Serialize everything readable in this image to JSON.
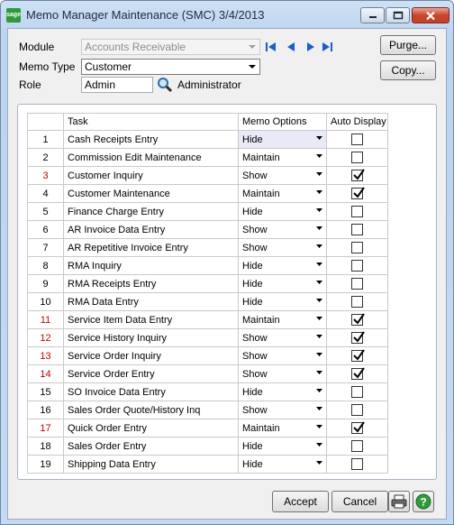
{
  "window": {
    "title": "Memo Manager Maintenance (SMC) 3/4/2013",
    "app_logo_text": "sage"
  },
  "form": {
    "module_label": "Module",
    "module_value": "Accounts Receivable",
    "memo_type_label": "Memo Type",
    "memo_type_value": "Customer",
    "role_label": "Role",
    "role_value": "Admin",
    "role_description": "Administrator"
  },
  "buttons": {
    "purge": "Purge...",
    "copy": "Copy...",
    "accept": "Accept",
    "cancel": "Cancel"
  },
  "grid": {
    "headers": [
      "",
      "Task",
      "Memo Options",
      "Auto Display"
    ],
    "rows": [
      {
        "num": "1",
        "task": "Cash Receipts Entry",
        "option": "Hide",
        "auto": false,
        "red": false
      },
      {
        "num": "2",
        "task": "Commission Edit Maintenance",
        "option": "Maintain",
        "auto": false,
        "red": false
      },
      {
        "num": "3",
        "task": "Customer Inquiry",
        "option": "Show",
        "auto": true,
        "red": true
      },
      {
        "num": "4",
        "task": "Customer Maintenance",
        "option": "Maintain",
        "auto": true,
        "red": false
      },
      {
        "num": "5",
        "task": "Finance Charge Entry",
        "option": "Hide",
        "auto": false,
        "red": false
      },
      {
        "num": "6",
        "task": "AR Invoice Data Entry",
        "option": "Show",
        "auto": false,
        "red": false
      },
      {
        "num": "7",
        "task": "AR Repetitive Invoice Entry",
        "option": "Show",
        "auto": false,
        "red": false
      },
      {
        "num": "8",
        "task": "RMA Inquiry",
        "option": "Hide",
        "auto": false,
        "red": false
      },
      {
        "num": "9",
        "task": "RMA Receipts Entry",
        "option": "Hide",
        "auto": false,
        "red": false
      },
      {
        "num": "10",
        "task": "RMA Data Entry",
        "option": "Hide",
        "auto": false,
        "red": false
      },
      {
        "num": "11",
        "task": "Service Item Data Entry",
        "option": "Maintain",
        "auto": true,
        "red": true
      },
      {
        "num": "12",
        "task": "Service History Inquiry",
        "option": "Show",
        "auto": true,
        "red": true
      },
      {
        "num": "13",
        "task": "Service Order Inquiry",
        "option": "Show",
        "auto": true,
        "red": true
      },
      {
        "num": "14",
        "task": "Service Order Entry",
        "option": "Show",
        "auto": true,
        "red": true
      },
      {
        "num": "15",
        "task": "SO Invoice Data Entry",
        "option": "Hide",
        "auto": false,
        "red": false
      },
      {
        "num": "16",
        "task": "Sales Order Quote/History Inq",
        "option": "Show",
        "auto": false,
        "red": false
      },
      {
        "num": "17",
        "task": "Quick Order Entry",
        "option": "Maintain",
        "auto": true,
        "red": true
      },
      {
        "num": "18",
        "task": "Sales Order Entry",
        "option": "Hide",
        "auto": false,
        "red": false
      },
      {
        "num": "19",
        "task": "Shipping Data Entry",
        "option": "Hide",
        "auto": false,
        "red": false
      }
    ]
  }
}
